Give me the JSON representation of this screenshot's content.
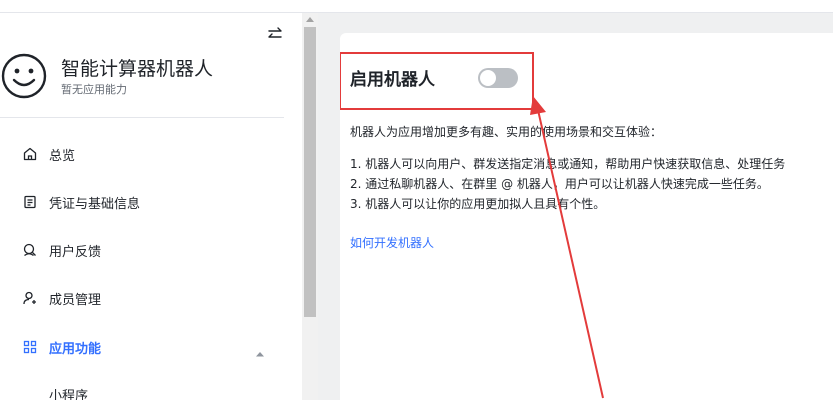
{
  "app": {
    "name": "智能计算器机器人",
    "subtitle": "暂无应用能力"
  },
  "sidebar": {
    "items": [
      {
        "label": "总览",
        "icon": "home-icon"
      },
      {
        "label": "凭证与基础信息",
        "icon": "document-icon"
      },
      {
        "label": "用户反馈",
        "icon": "feedback-icon"
      },
      {
        "label": "成员管理",
        "icon": "user-add-icon"
      },
      {
        "label": "应用功能",
        "icon": "grid-icon"
      }
    ],
    "sub_items": [
      {
        "label": "小程序"
      }
    ]
  },
  "main": {
    "title": "启用机器人",
    "intro": "机器人为应用增加更多有趣、实用的使用场景和交互体验：",
    "points": [
      "1. 机器人可以向用户、群发送指定消息或通知，帮助用户快速获取信息、处理任务",
      "2. 通过私聊机器人、在群里 @ 机器人，用户可以让机器人快速完成一些任务。",
      "3. 机器人可以让你的应用更加拟人且具有个性。"
    ],
    "link": "如何开发机器人",
    "toggle_on": false
  },
  "colors": {
    "accent": "#3370ff",
    "annotation": "#e33b3b",
    "toggle_off": "#bbbfc4",
    "content_bg": "#eff0f1"
  }
}
